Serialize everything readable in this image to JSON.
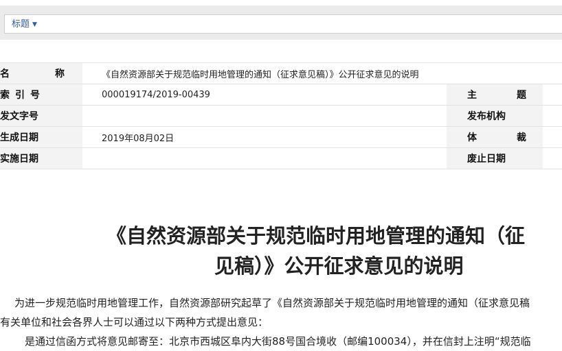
{
  "toolbar": {
    "title_dropdown": "标题"
  },
  "meta": {
    "name_label": "名　称",
    "name_value": "《自然资源部关于规范临时用地管理的通知（征求意见稿）》公开征求意见的说明",
    "index_label": "索引号",
    "index_value": "000019174/2019-00439",
    "topic_label": "主　题",
    "topic_value": "",
    "docno_label": "发文字号",
    "docno_value": "",
    "publisher_label": "发布机构",
    "publisher_value": "",
    "created_label": "生成日期",
    "created_value": "2019年08月02日",
    "genre_label": "体　裁",
    "genre_value": "",
    "effective_label": "实施日期",
    "effective_value": "",
    "expiry_label": "废止日期",
    "expiry_value": ""
  },
  "document": {
    "title_line1": "《自然资源部关于规范临时用地管理的通知（征",
    "title_line2": "见稿）》公开征求意见的说明",
    "para1": "为进一步规范临时用地管理工作，自然资源部研究起草了《自然资源部关于规范临时用地管理的通知（征求意见稿",
    "para2": "有关单位和社会各界人士可以通过以下两种方式提出意见：",
    "para3": "是通过信函方式将意见邮寄至：北京市西城区阜内大街88号国合境收（邮编100034），并在信封上注明“规范临"
  }
}
